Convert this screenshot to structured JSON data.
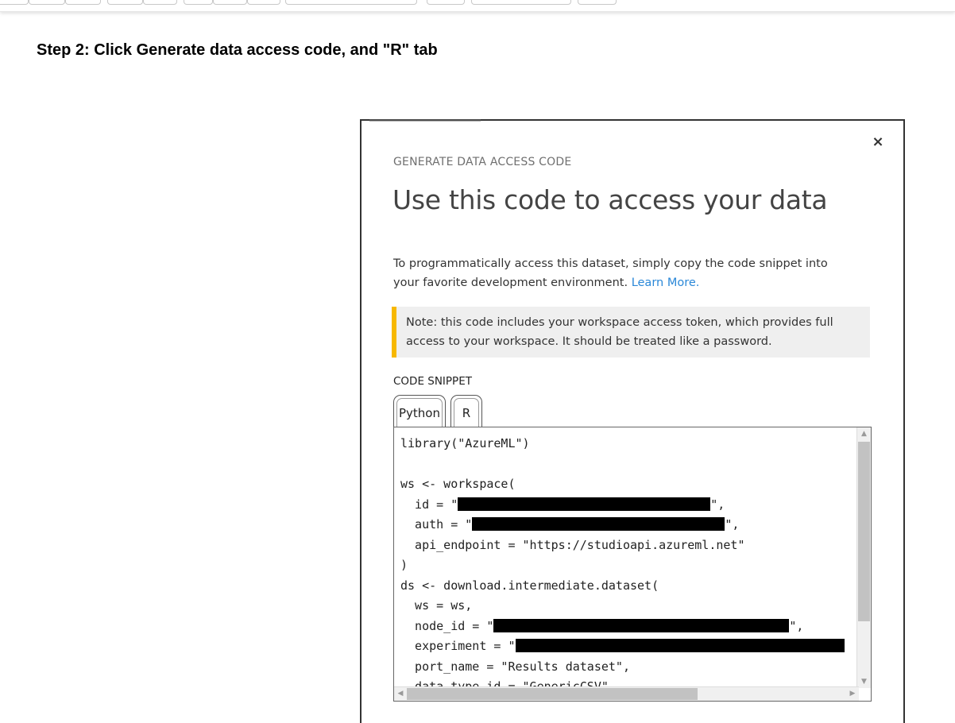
{
  "step_heading": "Step 2: Click Generate data access code, and \"R\" tab",
  "dialog": {
    "eyebrow": "GENERATE DATA ACCESS CODE",
    "title": "Use this code to access your data",
    "close_symbol": "×",
    "description": "To programmatically access this dataset, simply copy the code snippet into your favorite development environment.",
    "learn_more_link": "Learn More.",
    "note": "Note: this code includes your workspace access token, which provides full access to your workspace. It should be treated like a password.",
    "note_accent_color": "#f7b800",
    "link_color": "#2b88d8",
    "snippet_label": "CODE SNIPPET",
    "tabs": [
      {
        "label": "Python",
        "active": false
      },
      {
        "label": "R",
        "active": true
      }
    ],
    "code": {
      "line1": "library(\"AzureML\")",
      "line2": "ws <- workspace(",
      "id_prefix": "  id = \"",
      "id_suffix": "\",",
      "auth_prefix": "  auth = \"",
      "auth_suffix": "\",",
      "api_line": "  api_endpoint = \"https://studioapi.azureml.net\"",
      "close_paren": ")",
      "ds_line": "ds <- download.intermediate.dataset(",
      "ws_line": "  ws = ws,",
      "node_prefix": "  node_id = \"",
      "node_suffix": "\",",
      "exp_prefix": "  experiment = \"",
      "port_line": "  port_name = \"Results dataset\",",
      "dtype_line": "  data_type_id = \"GenericCSV\""
    }
  },
  "icons": {
    "close": "close-icon",
    "scroll_up": "chevron-up-icon",
    "scroll_down": "chevron-down-icon",
    "scroll_left": "chevron-left-icon",
    "scroll_right": "chevron-right-icon"
  }
}
